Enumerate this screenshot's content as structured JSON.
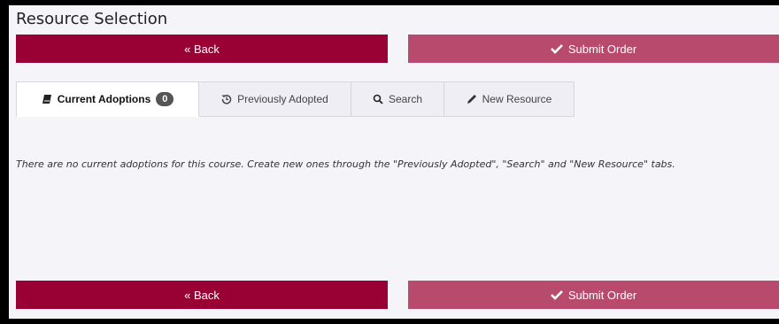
{
  "page": {
    "title": "Resource Selection"
  },
  "actions": {
    "back_label": "« Back",
    "submit_label": "Submit Order"
  },
  "tabs": [
    {
      "label": "Current Adoptions",
      "badge": "0",
      "icon": "book-icon",
      "active": true
    },
    {
      "label": "Previously Adopted",
      "icon": "history-icon",
      "active": false
    },
    {
      "label": "Search",
      "icon": "search-icon",
      "active": false
    },
    {
      "label": "New Resource",
      "icon": "pencil-icon",
      "active": false
    }
  ],
  "content": {
    "empty_message": "There are no current adoptions for this course. Create new ones through the \"Previously Adopted\", \"Search\" and \"New Resource\" tabs."
  },
  "colors": {
    "primary": "#990033",
    "secondary": "#b84a6e",
    "panel_bg": "#f4f4f9"
  }
}
